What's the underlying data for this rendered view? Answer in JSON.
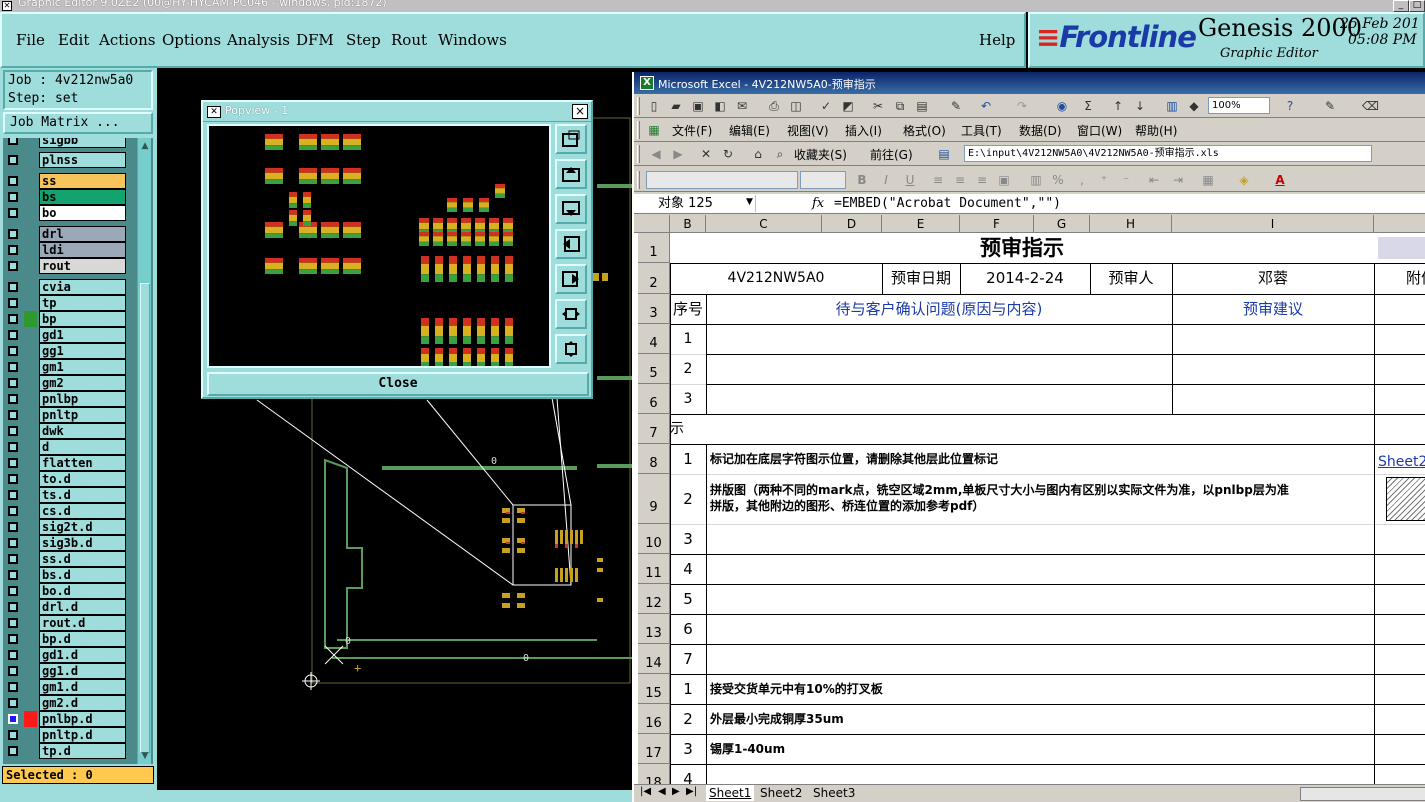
{
  "window": {
    "title": "Graphic Editor 9.0ZE2 (00@HY-HYCAM-PC046 - windows, pid:1872)"
  },
  "menu": {
    "items": [
      "File",
      "Edit",
      "Actions",
      "Options",
      "Analysis",
      "DFM",
      "Step",
      "Rout",
      "Windows"
    ],
    "help": "Help"
  },
  "brand": {
    "logo": "Frontline",
    "product": "Genesis 2000",
    "subtitle": "Graphic Editor",
    "date": "25 Feb 201",
    "time": "05:08 PM"
  },
  "job": {
    "job_line": "Job : 4v212nw5a0",
    "step_line": "Step: set",
    "matrix_button": "Job Matrix ..."
  },
  "layers": [
    {
      "name": "sigbb",
      "color": ""
    },
    {
      "name": "plnss",
      "color": ""
    },
    {
      "name": "ss",
      "color": "#f7c35b"
    },
    {
      "name": "bs",
      "color": "#14a36f"
    },
    {
      "name": "bo",
      "color": "#ffffff"
    },
    {
      "name": "drl",
      "color": "#9aa8b8"
    },
    {
      "name": "ldi",
      "color": "#9aa8b8"
    },
    {
      "name": "rout",
      "color": "#d8d8d8"
    },
    {
      "name": "cvia",
      "color": ""
    },
    {
      "name": "tp",
      "color": ""
    },
    {
      "name": "bp",
      "color": "",
      "swatch": "#2c9a2c"
    },
    {
      "name": "gd1",
      "color": ""
    },
    {
      "name": "gg1",
      "color": ""
    },
    {
      "name": "gm1",
      "color": ""
    },
    {
      "name": "gm2",
      "color": ""
    },
    {
      "name": "pnlbp",
      "color": ""
    },
    {
      "name": "pnltp",
      "color": ""
    },
    {
      "name": "dwk",
      "color": ""
    },
    {
      "name": "d",
      "color": ""
    },
    {
      "name": "flatten",
      "color": ""
    },
    {
      "name": "to.d",
      "color": ""
    },
    {
      "name": "ts.d",
      "color": ""
    },
    {
      "name": "cs.d",
      "color": ""
    },
    {
      "name": "sig2t.d",
      "color": ""
    },
    {
      "name": "sig3b.d",
      "color": ""
    },
    {
      "name": "ss.d",
      "color": ""
    },
    {
      "name": "bs.d",
      "color": ""
    },
    {
      "name": "bo.d",
      "color": ""
    },
    {
      "name": "drl.d",
      "color": ""
    },
    {
      "name": "rout.d",
      "color": ""
    },
    {
      "name": "bp.d",
      "color": ""
    },
    {
      "name": "gd1.d",
      "color": ""
    },
    {
      "name": "gg1.d",
      "color": ""
    },
    {
      "name": "gm1.d",
      "color": ""
    },
    {
      "name": "gm2.d",
      "color": ""
    },
    {
      "name": "pnlbp.d",
      "color": "",
      "swatch": "#ff1a1a"
    },
    {
      "name": "pnltp.d",
      "color": ""
    },
    {
      "name": "tp.d",
      "color": ""
    }
  ],
  "selected": "Selected : 0",
  "popview": {
    "title": "Popview - 1",
    "close_button": "Close",
    "close_x": "×"
  },
  "excel": {
    "title": "Microsoft Excel - 4V212NW5A0-预审指示",
    "menus": [
      "文件(F)",
      "编辑(E)",
      "视图(V)",
      "插入(I)",
      "格式(O)",
      "工具(T)",
      "数据(D)",
      "窗口(W)",
      "帮助(H)"
    ],
    "zoom": "100%",
    "favorites": "收藏夹(S)",
    "goto": "前往(G)",
    "address": "E:\\input\\4V212NW5A0\\4V212NW5A0-预审指示.xls",
    "namebox": "对象 125",
    "fx": "fx",
    "formula": "=EMBED(\"Acrobat Document\",\"\")",
    "columns": [
      "B",
      "C",
      "D",
      "E",
      "F",
      "G",
      "H",
      "I"
    ],
    "rows": [
      "1",
      "2",
      "3",
      "4",
      "5",
      "6",
      "7",
      "8",
      "9",
      "10",
      "11",
      "12",
      "13",
      "14",
      "15",
      "16",
      "17",
      "18"
    ],
    "sheet_title": "预审指示",
    "job_no": "4V212NW5A0",
    "review_date_label": "预审日期",
    "review_date": "2014-2-24",
    "reviewer_label": "预审人",
    "reviewer": "邓蓉",
    "attach_label": "附件",
    "header_seq": "序号",
    "header_issue": "待与客户确认问题(原因与内容)",
    "header_advice": "预审建议",
    "q_nums": [
      "1",
      "2",
      "3"
    ],
    "row7_text": "示",
    "instructions": [
      {
        "n": "1",
        "text": "标记加在底层字符图示位置，请删除其他层此位置标记"
      },
      {
        "n": "2",
        "text": "拼版图（两种不同的mark点，铣空区域2mm,单板尺寸大小与图内有区别以实际文件为准，以pnlbp层为准",
        "text2": "拼版，其他附边的图形、桥连位置的添加参考pdf）"
      },
      {
        "n": "3",
        "text": ""
      },
      {
        "n": "4",
        "text": ""
      },
      {
        "n": "5",
        "text": ""
      },
      {
        "n": "6",
        "text": ""
      },
      {
        "n": "7",
        "text": ""
      },
      {
        "n": "1",
        "text": "接受交货单元中有10%的打叉板"
      },
      {
        "n": "2",
        "text": "外层最小完成铜厚35um"
      },
      {
        "n": "3",
        "text": "锡厚1-40um"
      },
      {
        "n": "4",
        "text": ""
      }
    ],
    "sheet2_link": "Sheet2",
    "tabs": [
      "Sheet1",
      "Sheet2",
      "Sheet3"
    ]
  }
}
